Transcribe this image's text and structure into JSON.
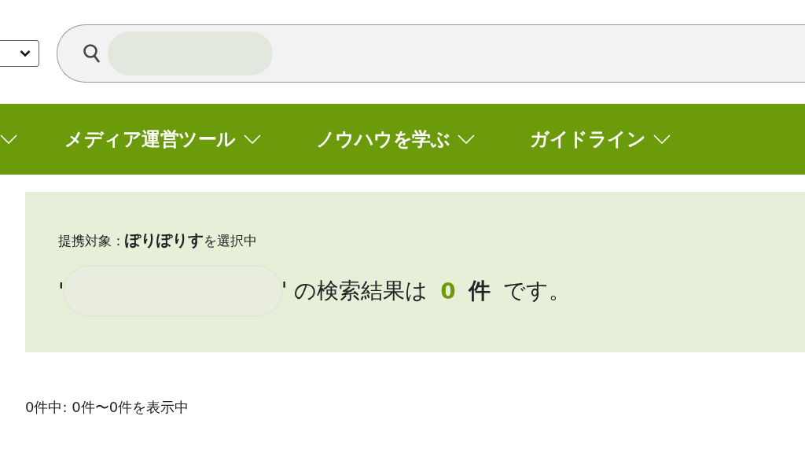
{
  "nav": {
    "items": [
      {
        "label": "メディア運営ツール"
      },
      {
        "label": "ノウハウを学ぶ"
      },
      {
        "label": "ガイドライン"
      }
    ]
  },
  "result_panel": {
    "partner_line": "提携対象：**ぽりぽりす**を選択中",
    "quote_open": "'",
    "quote_close": "' の検索結果は",
    "count": "0",
    "unit": "件",
    "tail": "です。"
  },
  "pagination_info": "0件中: 0件〜0件を表示中"
}
